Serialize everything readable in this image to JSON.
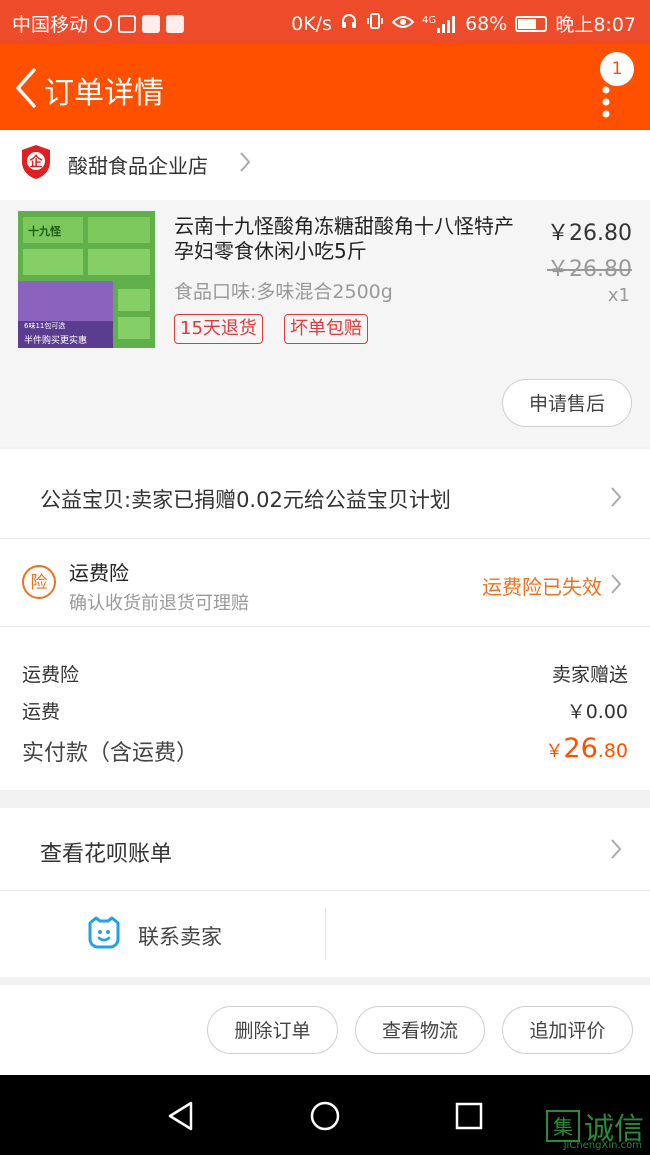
{
  "status_bar": {
    "carrier": "中国移动",
    "network_speed": "0K/s",
    "signal": "4G",
    "battery": "68%",
    "battery_level": 0.68,
    "time": "晚上8:07"
  },
  "header": {
    "title": "订单详情",
    "notification_count": "1"
  },
  "shop": {
    "badge_char": "企",
    "name": "酸甜食品企业店"
  },
  "product": {
    "title": "云南十九怪酸角冻糖甜酸角十八怪特产孕妇零食休闲小吃5斤",
    "spec": "食品口味:多味混合2500g",
    "tags": [
      "15天退货",
      "坏单包赔"
    ],
    "price": "￥26.80",
    "original_price": "￥26.80",
    "quantity": "x1",
    "after_sale_label": "申请售后",
    "thumbnail_text": {
      "line1": "十九怪",
      "line2": "6味11包可选",
      "line3": "半件购买更实惠"
    }
  },
  "charity": {
    "text": "公益宝贝:卖家已捐赠0.02元给公益宝贝计划"
  },
  "insurance": {
    "icon_char": "险",
    "title": "运费险",
    "subtitle": "确认收货前退货可理赔",
    "status": "运费险已失效"
  },
  "summary": {
    "insurance_label": "运费险",
    "insurance_value": "卖家赠送",
    "shipping_label": "运费",
    "shipping_value": "￥0.00",
    "paid_label": "实付款（含运费）",
    "paid_currency": "￥",
    "paid_integer": "26",
    "paid_decimal": ".80"
  },
  "huabei": {
    "label": "查看花呗账单"
  },
  "contact": {
    "label": "联系卖家"
  },
  "actions": {
    "delete_label": "删除订单",
    "logistics_label": "查看物流",
    "review_label": "追加评价"
  },
  "watermark": {
    "char": "集",
    "text": "诚信",
    "url": "JiChengXin.com"
  },
  "colors": {
    "accent": "#ff5000",
    "insurance": "#f07020",
    "tag": "#e4393c"
  }
}
